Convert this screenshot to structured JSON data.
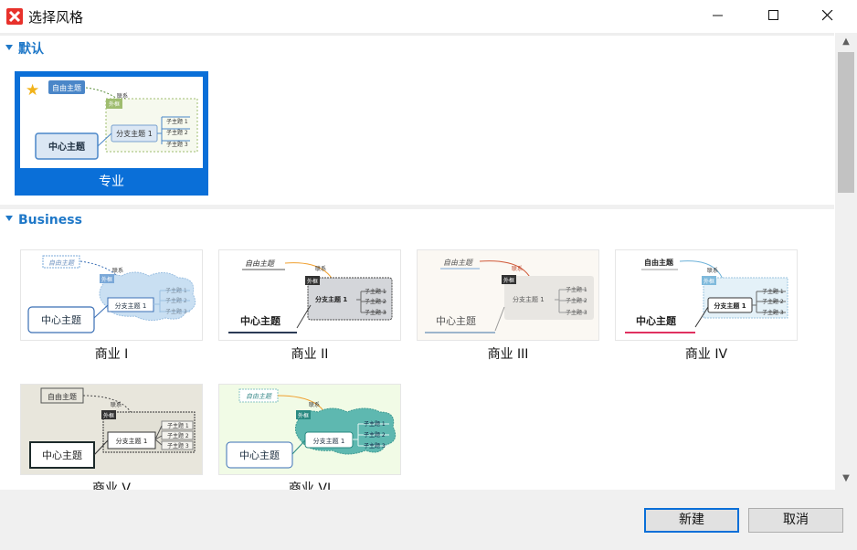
{
  "window": {
    "title": "选择风格"
  },
  "sections": {
    "default": {
      "label": "默认"
    },
    "business": {
      "label": "Business"
    }
  },
  "cards": {
    "pro": {
      "label": "专业"
    },
    "b1": {
      "label": "商业 I"
    },
    "b2": {
      "label": "商业 II"
    },
    "b3": {
      "label": "商业 III"
    },
    "b4": {
      "label": "商业 IV"
    },
    "b5": {
      "label": "商业 V"
    },
    "b6": {
      "label": "商业 VI"
    }
  },
  "preview_text": {
    "free_topic": "自由主题",
    "relationship": "联系",
    "boundary": "外框",
    "central_topic": "中心主题",
    "main_topic": "分支主题 1",
    "sub1": "子主题 1",
    "sub2": "子主题 2",
    "sub3": "子主题 3"
  },
  "buttons": {
    "create": "新建",
    "cancel": "取消"
  },
  "icons": {
    "minimize": "minimize-icon",
    "maximize": "maximize-icon",
    "close": "close-icon",
    "favorite": "star-icon"
  },
  "colors": {
    "accent": "#0a6fd8",
    "section_heading": "#1f78c8"
  }
}
